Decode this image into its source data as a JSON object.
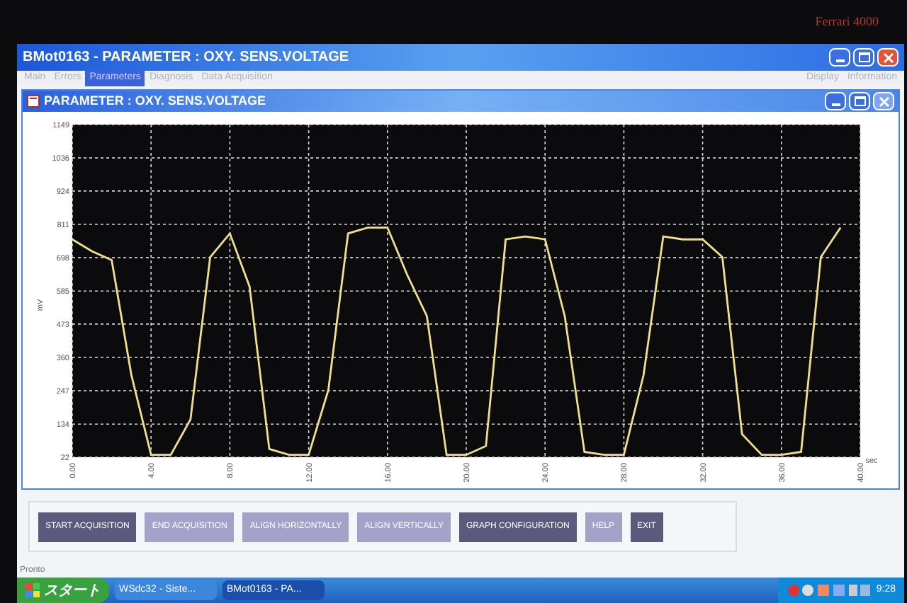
{
  "bezel": {
    "brand": "Ferrari 4000"
  },
  "window": {
    "title": "BMot0163 - PARAMETER : OXY. SENS.VOLTAGE"
  },
  "menu": {
    "items": [
      {
        "label": "Main",
        "selected": false
      },
      {
        "label": "Errors",
        "selected": false
      },
      {
        "label": "Parameters",
        "selected": true
      },
      {
        "label": "Diagnosis",
        "selected": false
      },
      {
        "label": "Data Acquisition",
        "selected": false
      }
    ],
    "right_items": [
      {
        "label": "Display"
      },
      {
        "label": "Information"
      }
    ]
  },
  "subwindow": {
    "title": "PARAMETER : OXY. SENS.VOLTAGE",
    "chart_data": {
      "type": "line",
      "xlabel": "sec",
      "ylabel": "mV",
      "x": [
        0,
        1,
        2,
        3,
        4,
        5,
        6,
        7,
        8,
        9,
        10,
        11,
        12,
        13,
        14,
        15,
        16,
        17,
        18,
        19,
        20,
        21,
        22,
        23,
        24,
        25,
        26,
        27,
        28,
        29,
        30,
        31,
        32,
        33,
        34,
        35,
        36,
        37,
        38,
        39
      ],
      "series": [
        {
          "color": "#f0e08a",
          "values": [
            760,
            720,
            690,
            300,
            30,
            30,
            150,
            700,
            780,
            600,
            50,
            30,
            30,
            250,
            780,
            800,
            800,
            640,
            500,
            30,
            30,
            60,
            760,
            770,
            760,
            500,
            40,
            30,
            30,
            300,
            770,
            760,
            760,
            700,
            100,
            30,
            30,
            40,
            700,
            800
          ]
        }
      ],
      "grid": true,
      "xlim": [
        0,
        40
      ],
      "ylim": [
        22,
        1149
      ],
      "xticks": [
        {
          "value": 0,
          "label": "0.00"
        },
        {
          "value": 4,
          "label": "4.00"
        },
        {
          "value": 8,
          "label": "8.00"
        },
        {
          "value": 12,
          "label": "12.00"
        },
        {
          "value": 16,
          "label": "16.00"
        },
        {
          "value": 20,
          "label": "20.00"
        },
        {
          "value": 24,
          "label": "24.00"
        },
        {
          "value": 28,
          "label": "28.00"
        },
        {
          "value": 32,
          "label": "32.00"
        },
        {
          "value": 36,
          "label": "36.00"
        },
        {
          "value": 40,
          "label": "40.00"
        }
      ],
      "yticks": [
        22,
        134,
        247,
        360,
        473,
        585,
        698,
        811,
        924,
        1036,
        1149
      ]
    }
  },
  "buttons": [
    {
      "label": "START ACQUISITION",
      "highlighted": true
    },
    {
      "label": "END ACQUISITION",
      "highlighted": false
    },
    {
      "label": "ALIGN HORIZONTALLY",
      "highlighted": false
    },
    {
      "label": "ALIGN VERTICALLY",
      "highlighted": false
    },
    {
      "label": "GRAPH CONFIGURATION",
      "highlighted": true
    },
    {
      "label": "HELP",
      "highlighted": false
    },
    {
      "label": "EXIT",
      "highlighted": true
    }
  ],
  "status_bar": {
    "text": "Pronto"
  },
  "taskbar": {
    "start": "スタート",
    "tasks": [
      {
        "label": "WSdc32 - Siste...",
        "selected": false
      },
      {
        "label": "BMot0163 - PA...",
        "selected": true
      }
    ],
    "clock": "9:28"
  }
}
